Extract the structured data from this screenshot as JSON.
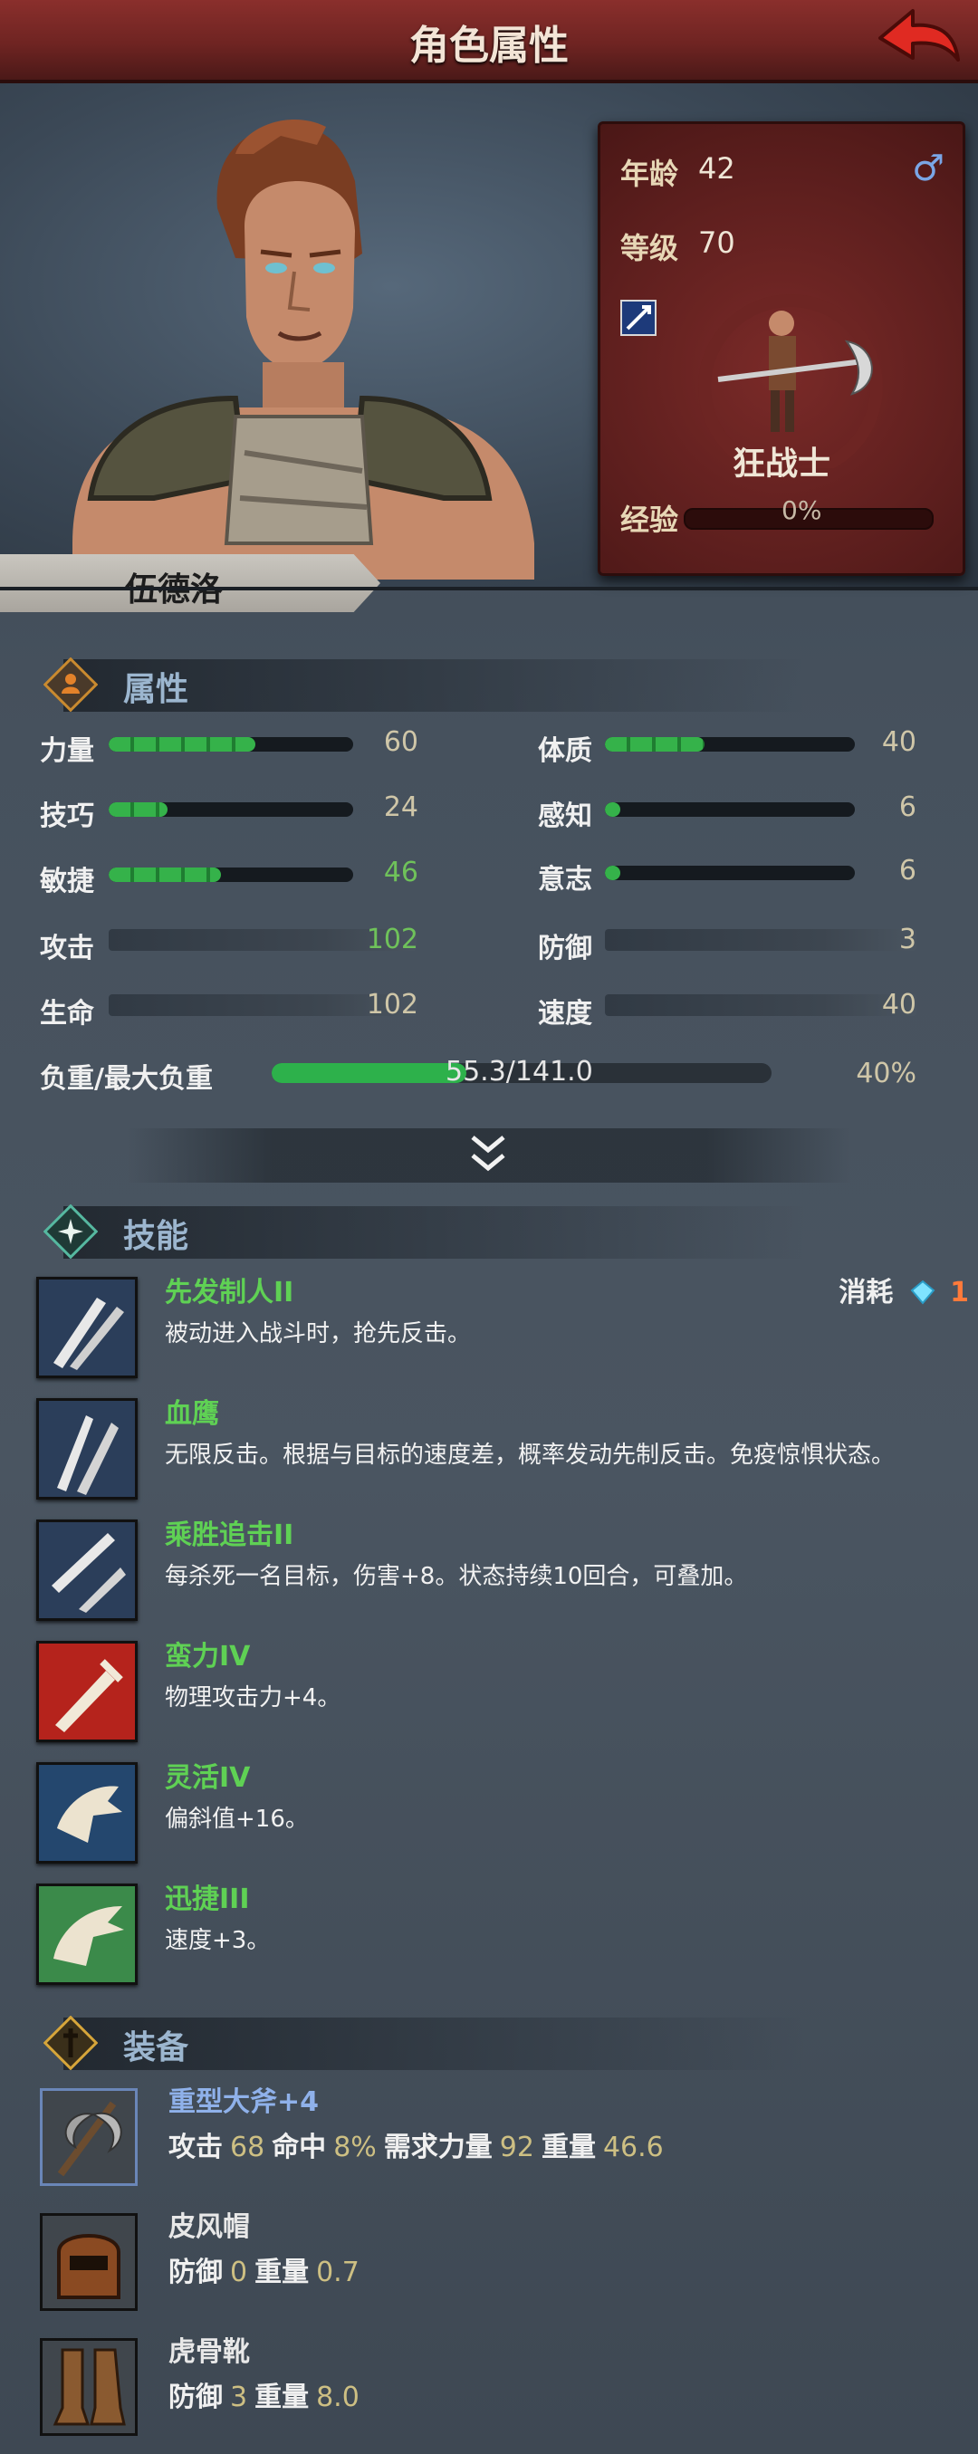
{
  "header": {
    "title": "角色属性"
  },
  "character": {
    "name": "伍德洛",
    "age_label": "年龄",
    "age": "42",
    "level_label": "等级",
    "level": "70",
    "gender_symbol": "♂",
    "class_name": "狂战士",
    "exp_label": "经验",
    "exp_value": "0%",
    "exp_progress": 0
  },
  "attributes_section": {
    "title": "属性"
  },
  "attributes": {
    "strength": {
      "label": "力量",
      "value": "60",
      "fill": 0.6
    },
    "constitution": {
      "label": "体质",
      "value": "40",
      "fill": 0.4
    },
    "skill": {
      "label": "技巧",
      "value": "24",
      "fill": 0.24
    },
    "perception": {
      "label": "感知",
      "value": "6",
      "fill": 0.06
    },
    "agility": {
      "label": "敏捷",
      "value": "46",
      "fill": 0.46
    },
    "will": {
      "label": "意志",
      "value": "6",
      "fill": 0.06
    },
    "attack": {
      "label": "攻击",
      "value": "102"
    },
    "defense": {
      "label": "防御",
      "value": "3"
    },
    "hp": {
      "label": "生命",
      "value": "102"
    },
    "speed": {
      "label": "速度",
      "value": "40"
    },
    "load": {
      "label": "负重/最大负重",
      "value": "55.3/141.0",
      "percent": "40%",
      "fill": 0.392
    }
  },
  "skills_section": {
    "title": "技能"
  },
  "skill_cost": {
    "label": "消耗",
    "value": "1"
  },
  "skills": [
    {
      "name": "先发制人II",
      "desc": "被动进入战斗时，抢先反击。"
    },
    {
      "name": "血鹰",
      "desc": "无限反击。根据与目标的速度差，概率发动先制反击。免疫惊惧状态。"
    },
    {
      "name": "乘胜追击II",
      "desc": "每杀死一名目标，伤害+8。状态持续10回合，可叠加。"
    },
    {
      "name": "蛮力IV",
      "desc": "物理攻击力+4。"
    },
    {
      "name": "灵活IV",
      "desc": "偏斜值+16。"
    },
    {
      "name": "迅捷III",
      "desc": "速度+3。"
    }
  ],
  "equipment_section": {
    "title": "装备"
  },
  "equipment": [
    {
      "name": "重型大斧+4",
      "stats": [
        {
          "label": "攻击",
          "value": "68"
        },
        {
          "label": "命中",
          "value": "8%"
        },
        {
          "label": "需求力量",
          "value": "92"
        },
        {
          "label": "重量",
          "value": "46.6"
        }
      ]
    },
    {
      "name": "皮风帽",
      "stats": [
        {
          "label": "防御",
          "value": "0"
        },
        {
          "label": "重量",
          "value": "0.7"
        }
      ]
    },
    {
      "name": "虎骨靴",
      "stats": [
        {
          "label": "防御",
          "value": "3"
        },
        {
          "label": "重量",
          "value": "8.0"
        }
      ]
    }
  ],
  "colors": {
    "accent_red": "#7a2a28",
    "skill_green": "#5fd154",
    "bar_green": "#35b24a"
  },
  "icons": {
    "back": "back-arrow-icon",
    "gender": "male-icon",
    "attributes": "attributes-diamond-icon",
    "skills": "skills-diamond-icon",
    "equipment": "equipment-diamond-icon",
    "expand": "chevron-double-down-icon"
  }
}
